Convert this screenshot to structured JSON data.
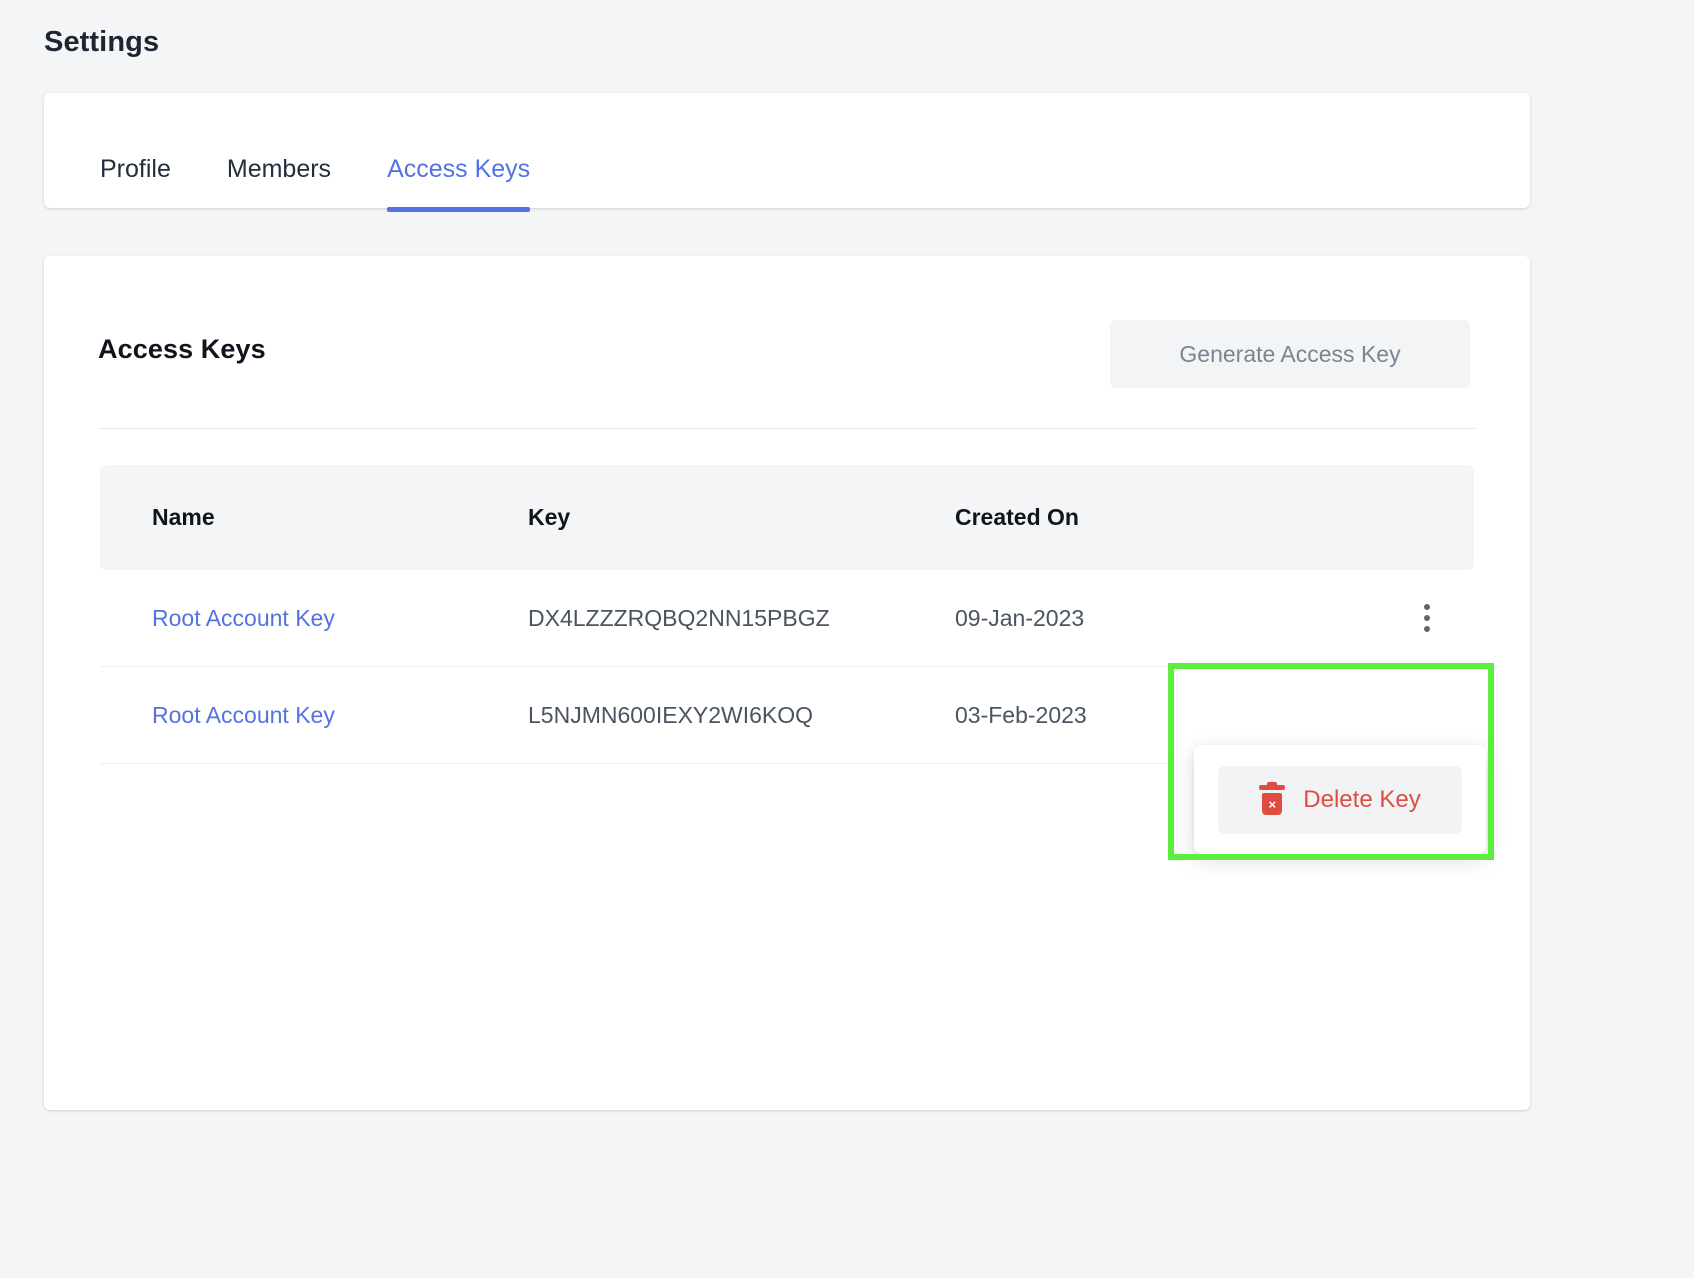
{
  "page": {
    "title": "Settings",
    "background_color": "#f4f5f7",
    "accent_color": "#5472e4",
    "danger_color": "#df4d42",
    "highlight_color": "#5ded3f"
  },
  "tabs": [
    {
      "label": "Profile",
      "active": false
    },
    {
      "label": "Members",
      "active": false
    },
    {
      "label": "Access Keys",
      "active": true
    }
  ],
  "section": {
    "title": "Access Keys",
    "generate_button": {
      "label": "Generate Access Key",
      "disabled": true
    }
  },
  "table": {
    "columns": [
      "Name",
      "Key",
      "Created On"
    ],
    "rows": [
      {
        "name": "Root Account Key",
        "key": "DX4LZZZRQBQ2NN15PBGZ",
        "created_on": "09-Jan-2023",
        "menu_icon": "kebab-menu-icon"
      },
      {
        "name": "Root Account Key",
        "key": "L5NJMN600IEXY2WI6KOQ",
        "created_on": "03-Feb-2023",
        "menu_icon": "kebab-menu-icon"
      }
    ]
  },
  "context_menu": {
    "open_for_row": 2,
    "items": [
      {
        "label": "Delete Key",
        "icon": "trash-icon",
        "icon_glyph": "×"
      }
    ]
  }
}
